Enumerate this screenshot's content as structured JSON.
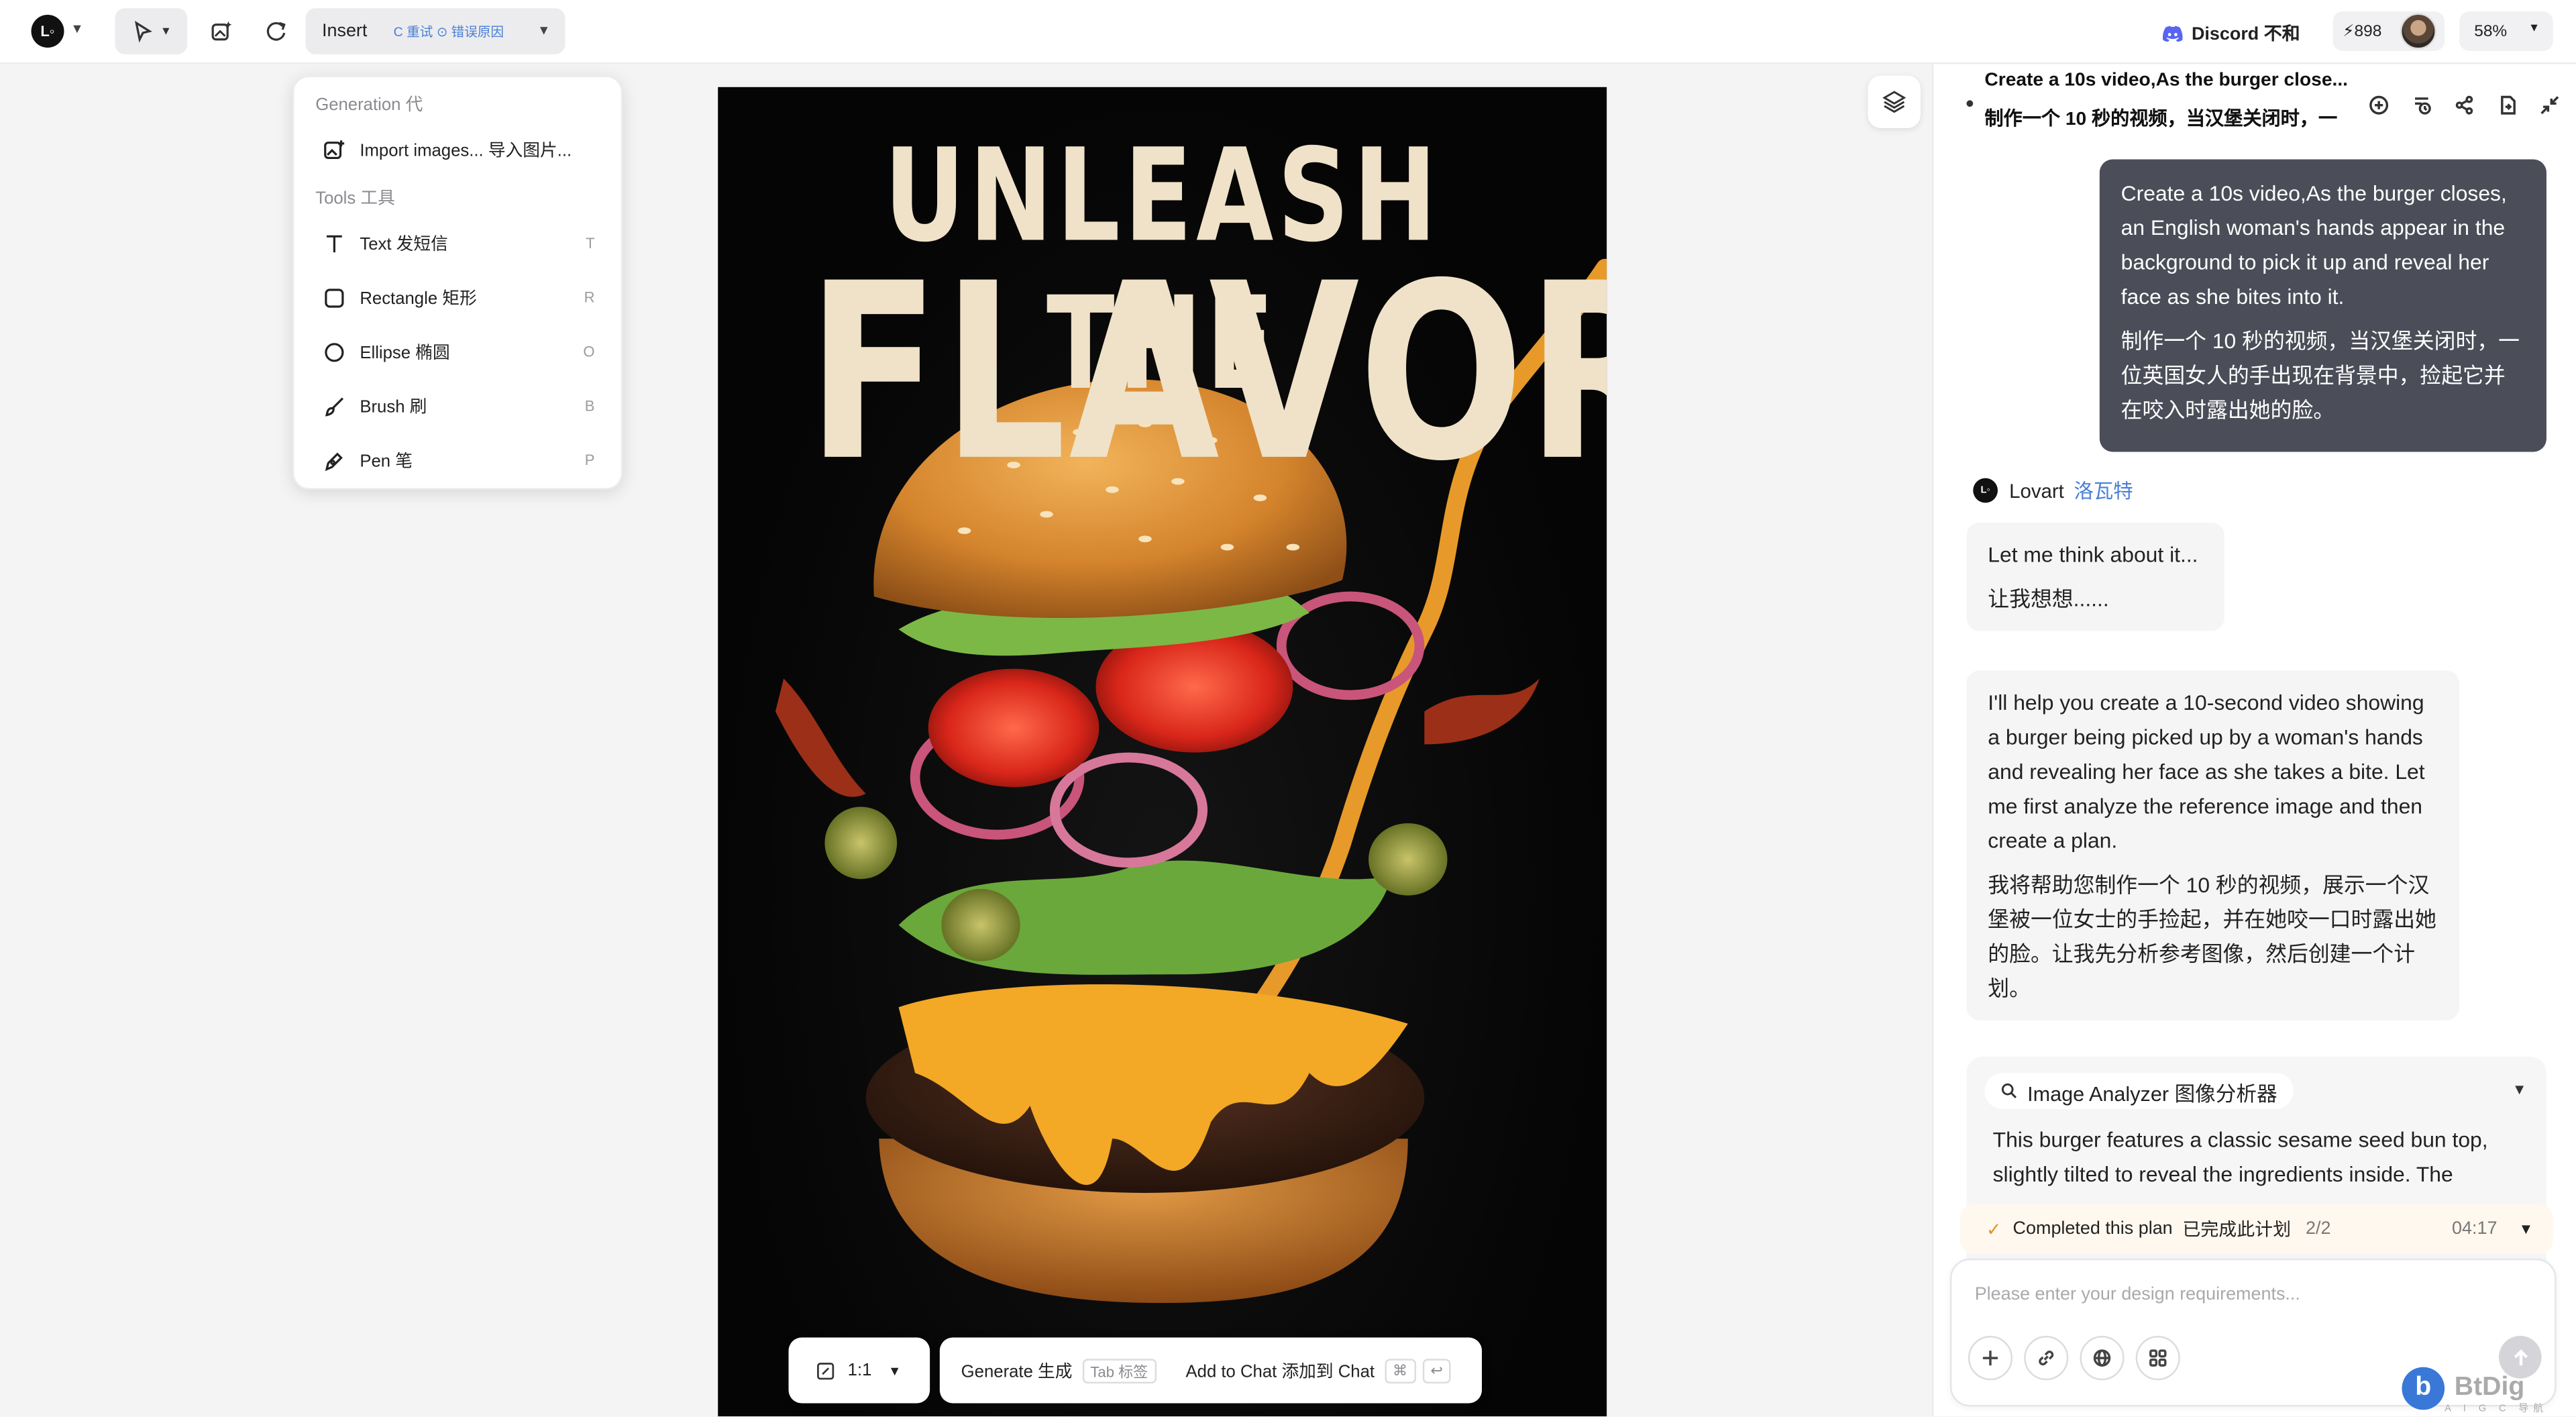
{
  "toolbar": {
    "logo_icon": "lovart-logo-icon",
    "insert_label": "Insert",
    "insert_retry": "C 重试 ⊙ 错误原因",
    "discord_label": "Discord 不和",
    "credits": "⚡898",
    "zoom": "58%"
  },
  "menu": {
    "generation_header": "Generation 代",
    "import_label": "Import images... 导入图片...",
    "tools_header": "Tools 工具",
    "items": [
      {
        "label": "Text 发短信",
        "shortcut": "T",
        "icon": "text-icon"
      },
      {
        "label": "Rectangle 矩形",
        "shortcut": "R",
        "icon": "rectangle-icon"
      },
      {
        "label": "Ellipse 椭圆",
        "shortcut": "O",
        "icon": "ellipse-icon"
      },
      {
        "label": "Brush 刷",
        "shortcut": "B",
        "icon": "brush-icon"
      },
      {
        "label": "Pen 笔",
        "shortcut": "P",
        "icon": "pen-icon"
      }
    ]
  },
  "canvas": {
    "poster_line1": "UNLEASH THE",
    "poster_line2": "FLAVOR",
    "ratio": "1:1",
    "generate_label": "Generate 生成",
    "tab_label": "Tab 标签",
    "add_chat_label": "Add to Chat 添加到 Chat",
    "cmd_key": "⌘",
    "enter_key": "↩"
  },
  "chat": {
    "title": "Create a 10s video,As the burger close...",
    "subtitle": "制作一个 10 秒的视频，当汉堡关闭时，一",
    "user_en": "Create a 10s video,As the burger closes, an English woman's hands appear in the background to pick it up and reveal her face as she bites into it.",
    "user_cn": "制作一个 10 秒的视频，当汉堡关闭时，一位英国女人的手出现在背景中，捡起它并在咬入时露出她的脸。",
    "agent_name": "Lovart",
    "agent_name_cn": "洛瓦特",
    "think_en": "Let me think about it...",
    "think_cn": "让我想想......",
    "plan_en": "I'll help you create a 10-second video showing a burger being picked up by a woman's hands and revealing her face as she takes a bite. Let me first analyze the reference image and then create a plan.",
    "plan_cn": "我将帮助您制作一个 10 秒的视频，展示一个汉堡被一位女士的手捡起，并在她咬一口时露出她的脸。让我先分析参考图像，然后创建一个计划。",
    "analyzer_label": "Image Analyzer 图像分析器",
    "analyzer_text": "This burger features a classic sesame seed bun top, slightly tilted to reveal the ingredients inside. The",
    "plan_status": "Completed this plan",
    "plan_status_cn": "已完成此计划",
    "plan_count": "2/2",
    "plan_time": "04:17",
    "input_placeholder": "Please enter your design requirements..."
  },
  "watermark": {
    "brand": "BtDig",
    "sub": "A I G C 导航站"
  },
  "colors": {
    "accent_blue": "#4a7fd6",
    "user_bubble": "#4b4e58",
    "plan_check": "#e0952c"
  }
}
